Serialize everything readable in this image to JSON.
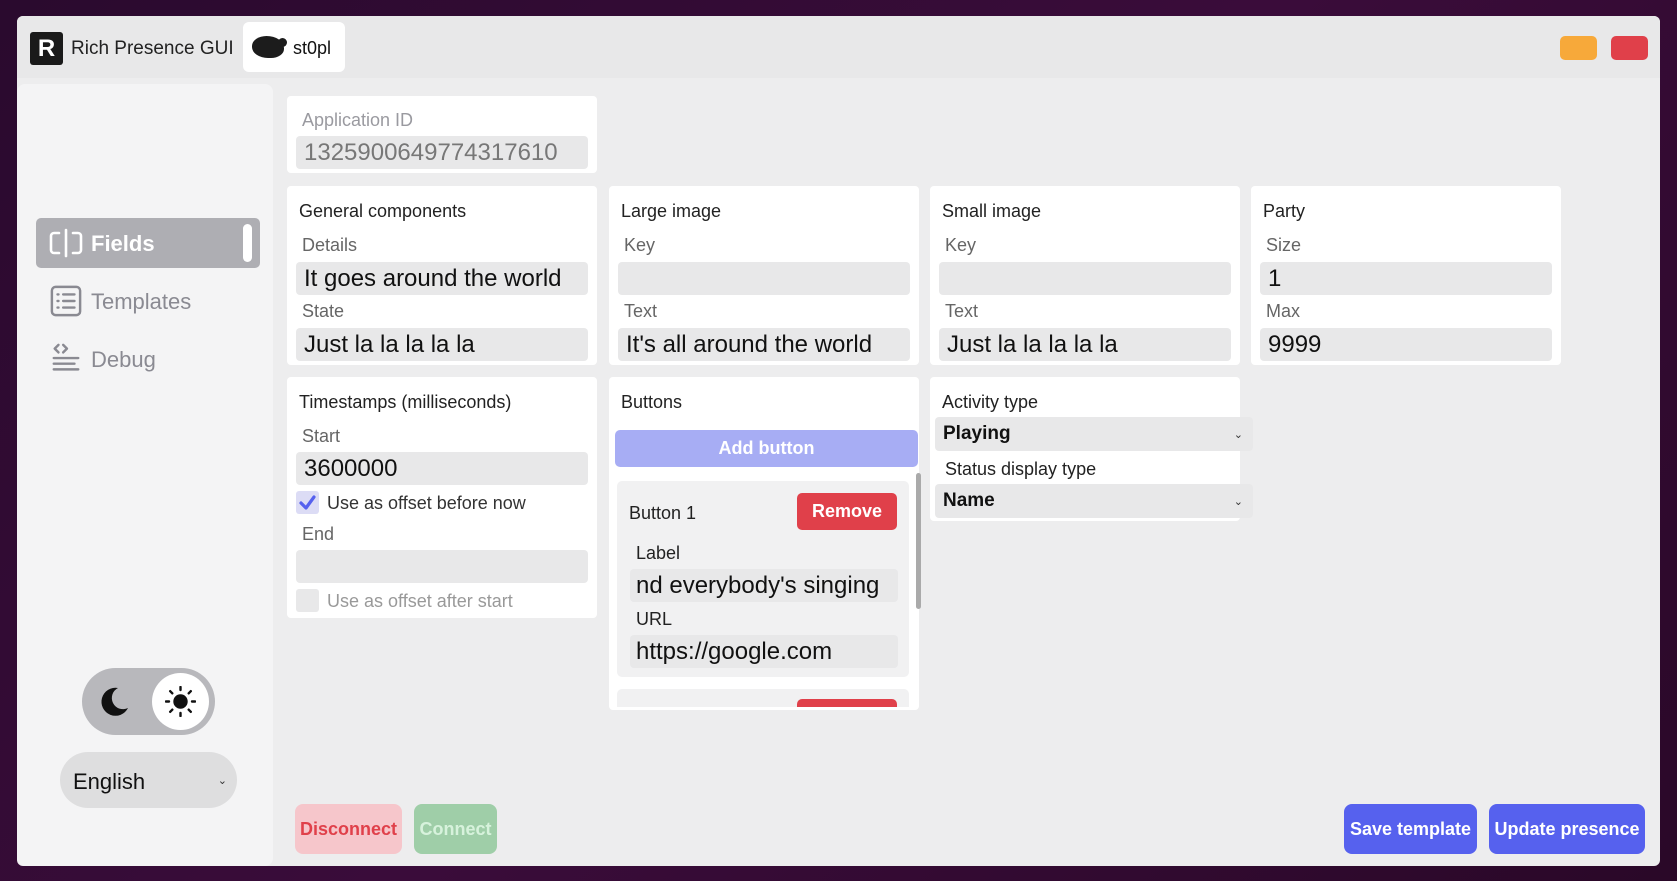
{
  "titlebar": {
    "app_title": "Rich Presence GUI",
    "logo_letter": "R",
    "user_name": "st0pl"
  },
  "sidebar": {
    "items": [
      {
        "label": "Fields",
        "icon": "text-cursor-icon",
        "active": true
      },
      {
        "label": "Templates",
        "icon": "list-icon",
        "active": false
      },
      {
        "label": "Debug",
        "icon": "code-lines-icon",
        "active": false
      }
    ],
    "theme": "light",
    "language": "English"
  },
  "application": {
    "label": "Application ID",
    "value": "1325900649774317610"
  },
  "general": {
    "title": "General components",
    "details_label": "Details",
    "details_value": "It goes around the world",
    "state_label": "State",
    "state_value": "Just la la la la la"
  },
  "large_image": {
    "title": "Large image",
    "key_label": "Key",
    "key_value": "",
    "text_label": "Text",
    "text_value": "It's all around the world"
  },
  "small_image": {
    "title": "Small image",
    "key_label": "Key",
    "key_value": "",
    "text_label": "Text",
    "text_value": "Just la la la la la"
  },
  "party": {
    "title": "Party",
    "size_label": "Size",
    "size_value": "1",
    "max_label": "Max",
    "max_value": "9999"
  },
  "timestamps": {
    "title": "Timestamps (milliseconds)",
    "start_label": "Start",
    "start_value": "3600000",
    "start_offset_label": "Use as offset before now",
    "start_offset_checked": true,
    "end_label": "End",
    "end_value": "",
    "end_offset_label": "Use as offset after start",
    "end_offset_checked": false
  },
  "buttons": {
    "title": "Buttons",
    "add_label": "Add button",
    "items": [
      {
        "name": "Button 1",
        "remove_label": "Remove",
        "label_label": "Label",
        "label_value": "nd everybody's singing",
        "url_label": "URL",
        "url_value": "https://google.com"
      }
    ]
  },
  "activity": {
    "title": "Activity type",
    "activity_value": "Playing",
    "status_label": "Status display type",
    "status_value": "Name"
  },
  "actions": {
    "disconnect": "Disconnect",
    "connect": "Connect",
    "save_template": "Save template",
    "update_presence": "Update presence"
  },
  "colors": {
    "accent": "#5661ee",
    "danger": "#e0404a",
    "success": "#9fcea8",
    "minimize": "#f7a93a"
  }
}
